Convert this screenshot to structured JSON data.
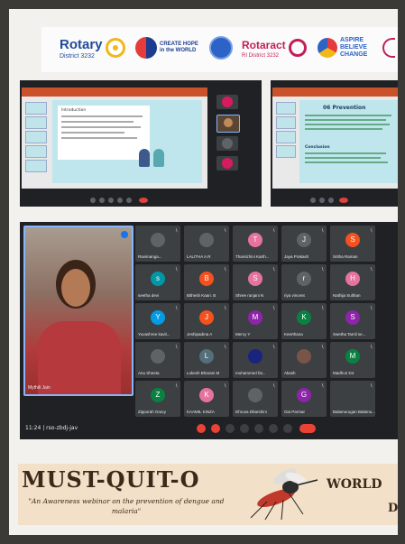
{
  "logos": {
    "rotary": {
      "name": "Rotary",
      "district": "District 3232"
    },
    "create_hope": {
      "line1": "CREATE HOPE",
      "line2": "in the WORLD"
    },
    "rotaract": {
      "name": "Rotaract",
      "district": "RI District 3232"
    },
    "aspire": {
      "line1": "ASPIRE",
      "line2": "BELIEVE",
      "line3": "CHANGE"
    }
  },
  "screen_left": {
    "slide_heading": "Introduction",
    "participant_tile": "You"
  },
  "screen_right": {
    "slide_heading": "06 Prevention",
    "subheading": "Conclusion"
  },
  "speaker": {
    "name": "Mythili Jain"
  },
  "participants": [
    {
      "name": "Ravimanga...",
      "initial": "",
      "color": "#5f6368"
    },
    {
      "name": "LALITHA A.R",
      "initial": "",
      "color": "#5f6368"
    },
    {
      "name": "Thamizhini Karth...",
      "initial": "T",
      "color": "#e5739e"
    },
    {
      "name": "Jaya Prakash",
      "initial": "J",
      "color": "#5f6368"
    },
    {
      "name": "Sritha Raman",
      "initial": "S",
      "color": "#f4511e"
    },
    {
      "name": "seetha devi",
      "initial": "s",
      "color": "#0097a7"
    },
    {
      "name": "Bithesh Kaari. B",
      "initial": "B",
      "color": "#f4511e"
    },
    {
      "name": "Shree ranjani N",
      "initial": "S",
      "color": "#e5739e"
    },
    {
      "name": "riya vincent",
      "initial": "r",
      "color": "#5f6368"
    },
    {
      "name": "Nathija Sulthan",
      "initial": "H",
      "color": "#e5739e"
    },
    {
      "name": "Yuvashree kavit...",
      "initial": "Y",
      "color": "#039be5"
    },
    {
      "name": "Jeshipadma A",
      "initial": "J",
      "color": "#f4511e"
    },
    {
      "name": "Mercy Y",
      "initial": "M",
      "color": "#8e24aa"
    },
    {
      "name": "Keerthana",
      "initial": "K",
      "color": "#0b8043"
    },
    {
      "name": "Swetha Tamil se...",
      "initial": "S",
      "color": "#8e24aa"
    },
    {
      "name": "Anu Sheeta",
      "initial": "",
      "color": "#5f6368"
    },
    {
      "name": "Lokesh Bharani M",
      "initial": "L",
      "color": "#546e7a"
    },
    {
      "name": "muhammed fai...",
      "initial": "",
      "color": "#1a237e"
    },
    {
      "name": "Akash",
      "initial": "",
      "color": "#795548"
    },
    {
      "name": "Madhuri D4",
      "initial": "M",
      "color": "#0b8043"
    },
    {
      "name": "Zipporah Gracy",
      "initial": "Z",
      "color": "#0b8043"
    },
    {
      "name": "KAAMIL KINZA",
      "initial": "K",
      "color": "#e5739e"
    },
    {
      "name": "Dhruva Dharshini",
      "initial": "",
      "color": "#5f6368"
    },
    {
      "name": "Gia Parmar",
      "initial": "G",
      "color": "#8e24aa"
    },
    {
      "name": "Balamurugan Balamu... raised a hand",
      "initial": "",
      "color": "#3c4043"
    }
  ],
  "bottombar": {
    "time": "11:24 | rso-zbdj-jav"
  },
  "banner": {
    "title": "MUST-QUIT-O",
    "subtitle_line1": "\"An Awareness webinar on the prevention of dengue and",
    "subtitle_line2": "malaria\"",
    "world": "WORLD",
    "d": "D"
  }
}
